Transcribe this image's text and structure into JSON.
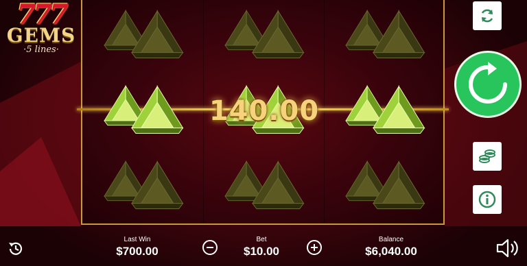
{
  "game": {
    "logo_sevens": "777",
    "logo_title": "GEMS",
    "logo_subtitle": "5 lines",
    "win_amount": "140.00"
  },
  "reels": {
    "columns": 3,
    "rows": 3,
    "symbol": "green-gem-pair-icon",
    "highlighted_row": 1
  },
  "bottom_bar": {
    "last_win_label": "Last Win",
    "last_win_value": "$700.00",
    "bet_label": "Bet",
    "bet_value": "$10.00",
    "balance_label": "Balance",
    "balance_value": "$6,040.00"
  },
  "sidebar": {
    "autoplay_icon": "refresh-icon",
    "spin_icon": "spin-arrow-icon",
    "coins_icon": "coins-icon",
    "info_icon": "info-icon"
  },
  "controls": {
    "history_icon": "history-icon",
    "minus_icon": "minus-icon",
    "plus_icon": "plus-icon",
    "sound_icon": "speaker-icon"
  },
  "colors": {
    "spin_button": "#28c45c",
    "frame_gold": "#c99a3a",
    "background_red": "#5a0812",
    "gem_green": "#9fd23a"
  }
}
